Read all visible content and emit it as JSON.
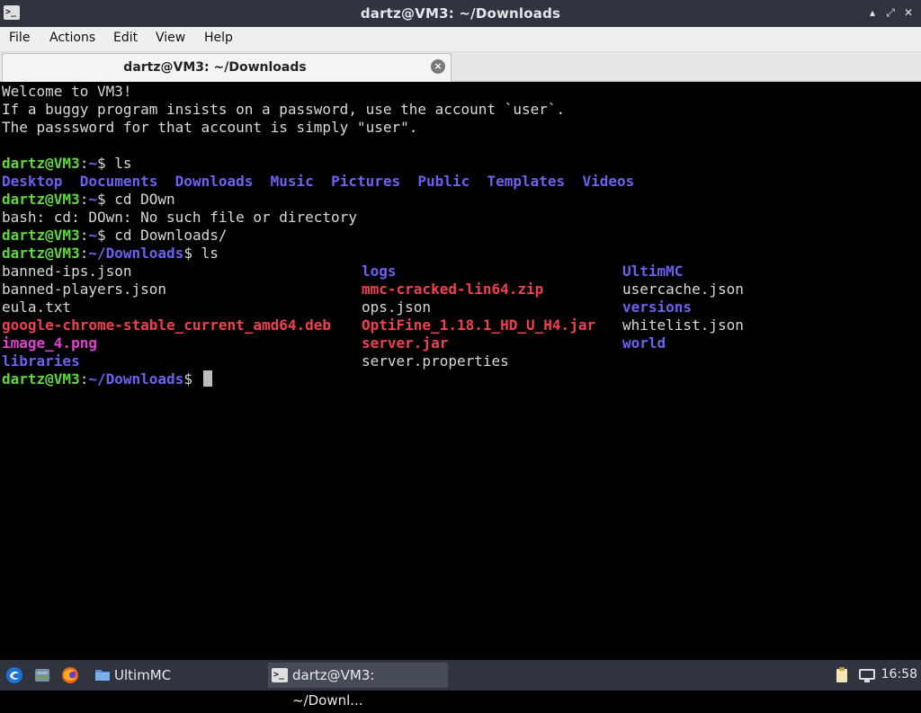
{
  "window": {
    "title": "dartz@VM3: ~/Downloads",
    "app_icon_glyph": ">_",
    "buttons": {
      "minimize": "▴",
      "restore": "⤢",
      "close": "✕"
    }
  },
  "menu": {
    "file": "File",
    "actions": "Actions",
    "edit": "Edit",
    "view": "View",
    "help": "Help"
  },
  "tab": {
    "label": "dartz@VM3: ~/Downloads",
    "close": "×"
  },
  "terminal": {
    "welcome": [
      "Welcome to VM3!",
      "If a buggy program insists on a password, use the account `user`.",
      "The passsword for that account is simply \"user\"."
    ],
    "prompt_user": "dartz@VM3",
    "prompt_home_path": "~",
    "prompt_dl_path": "~/Downloads",
    "prompt_sep": ":",
    "prompt_dollar": "$ ",
    "cmd_ls": "ls",
    "cmd_cd_wrong": "cd DOwn",
    "cmd_cd_right": "cd Downloads/",
    "home_dirs": [
      "Desktop",
      "Documents",
      "Downloads",
      "Music",
      "Pictures",
      "Public",
      "Templates",
      "Videos"
    ],
    "error_line": "bash: cd: DOwn: No such file or directory",
    "files_col1": [
      {
        "name": "banned-ips.json",
        "type": "file"
      },
      {
        "name": "banned-players.json",
        "type": "file"
      },
      {
        "name": "eula.txt",
        "type": "file"
      },
      {
        "name": "google-chrome-stable_current_amd64.deb",
        "type": "archive"
      },
      {
        "name": "image_4.png",
        "type": "image"
      },
      {
        "name": "libraries",
        "type": "dir"
      }
    ],
    "files_col2": [
      {
        "name": "logs",
        "type": "dir"
      },
      {
        "name": "mmc-cracked-lin64.zip",
        "type": "archive"
      },
      {
        "name": "ops.json",
        "type": "file"
      },
      {
        "name": "OptiFine_1.18.1_HD_U_H4.jar",
        "type": "archive"
      },
      {
        "name": "server.jar",
        "type": "archive"
      },
      {
        "name": "server.properties",
        "type": "file"
      }
    ],
    "files_col3": [
      {
        "name": "UltimMC",
        "type": "dir"
      },
      {
        "name": "usercache.json",
        "type": "file"
      },
      {
        "name": "versions",
        "type": "dir"
      },
      {
        "name": "whitelist.json",
        "type": "file"
      },
      {
        "name": "world",
        "type": "dir"
      }
    ]
  },
  "taskbar": {
    "launchers": [
      "start-menu-icon",
      "file-manager-icon",
      "firefox-icon"
    ],
    "tasks": [
      "UltimMC",
      "dartz@VM3: ~/Downl..."
    ],
    "tray": [
      "clipboard-icon",
      "network-icon"
    ],
    "clock": "16:58"
  },
  "colors": {
    "user": "#5ed83a",
    "path": "#6a62f0",
    "archive": "#f04050",
    "image": "#e040d0",
    "text": "#d8d8d8"
  }
}
